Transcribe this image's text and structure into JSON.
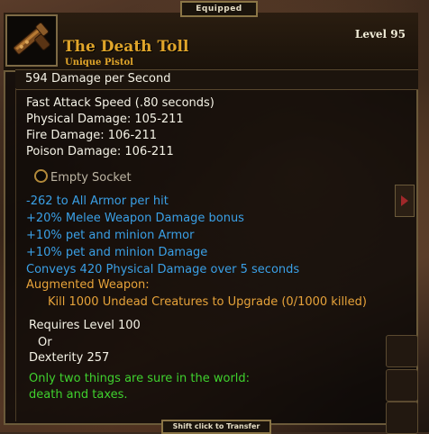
{
  "window": {
    "equipped_tab": "Equipped",
    "footer_hint": "Shift click to Transfer"
  },
  "item": {
    "name": "The Death Toll",
    "type": "Unique Pistol",
    "level": "Level 95",
    "icon": "pistol-icon",
    "name_color": "#e0a52a"
  },
  "stats": {
    "dps": "594  Damage per Second",
    "attack_speed": "Fast Attack Speed (.80 seconds)",
    "physical": "Physical Damage: 105-211",
    "fire": "Fire Damage: 106-211",
    "poison": "Poison Damage: 106-211"
  },
  "socket": {
    "label": "Empty Socket",
    "icon": "socket-icon"
  },
  "bonuses": [
    "-262 to All Armor per hit",
    "+20% Melee Weapon Damage bonus",
    "+10% pet and minion Armor",
    "+10% pet and minion Damage",
    "Conveys 420 Physical Damage over 5 seconds"
  ],
  "augment": {
    "title": "Augmented Weapon:",
    "task": "Kill 1000 Undead Creatures to Upgrade (0/1000 killed)"
  },
  "requirements": {
    "level": "Requires Level 100",
    "or": "Or",
    "dexterity": "Dexterity 257"
  },
  "flavor": {
    "line1": "Only two things are sure in the world:",
    "line2": "death and taxes."
  },
  "colors": {
    "magic_blue": "#3aa0e6",
    "augment_orange": "#e7a33a",
    "flavor_green": "#3fd12e",
    "frame_gold": "#8a7546"
  }
}
